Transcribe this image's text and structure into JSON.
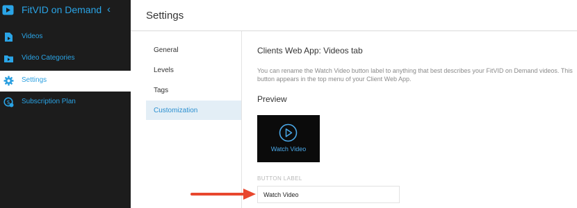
{
  "sidebar": {
    "app_title": "FitVID on Demand",
    "collapse_icon": "chevron-left-icon",
    "items": [
      {
        "label": "Videos",
        "icon": "video-file-icon"
      },
      {
        "label": "Video Categories",
        "icon": "video-folder-icon"
      },
      {
        "label": "Settings",
        "icon": "gear-icon",
        "active": true
      },
      {
        "label": "Subscription Plan",
        "icon": "subscription-icon"
      }
    ]
  },
  "page": {
    "title": "Settings"
  },
  "settings_nav": {
    "items": [
      {
        "label": "General"
      },
      {
        "label": "Levels"
      },
      {
        "label": "Tags"
      },
      {
        "label": "Customization",
        "active": true
      }
    ]
  },
  "content": {
    "section_title": "Clients Web App: Videos tab",
    "description": "You can rename the Watch Video button label to anything that best describes your FitVID on Demand videos. This button appears in the top menu of your Client Web App.",
    "preview_label": "Preview",
    "preview_button_text": "Watch Video",
    "field_label": "BUTTON LABEL",
    "field_value": "Watch Video"
  },
  "colors": {
    "sidebar_bg": "#1c1c1c",
    "accent": "#2aa4e6",
    "active_nav_bg": "#e3eef6",
    "annotation_arrow": "#e8472e"
  }
}
